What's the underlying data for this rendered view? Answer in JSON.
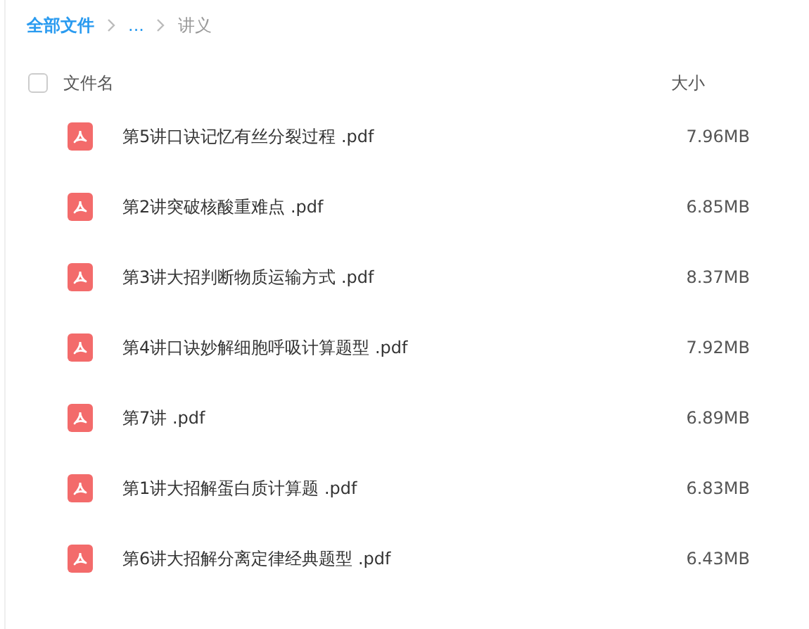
{
  "breadcrumb": [
    {
      "label": "全部文件",
      "kind": "link"
    },
    {
      "label": "...",
      "kind": "link"
    },
    {
      "label": "讲义",
      "kind": "current"
    }
  ],
  "table": {
    "select_all": {
      "checked": false
    },
    "columns": [
      "文件名",
      "大小"
    ],
    "rows": [
      {
        "name": "第5讲口诀记忆有丝分裂过程 .pdf",
        "size": "7.96MB"
      },
      {
        "name": "第2讲突破核酸重难点 .pdf",
        "size": "6.85MB"
      },
      {
        "name": "第3讲大招判断物质运输方式 .pdf",
        "size": "8.37MB"
      },
      {
        "name": "第4讲口诀妙解细胞呼吸计算题型 .pdf",
        "size": "7.92MB"
      },
      {
        "name": "第7讲 .pdf",
        "size": "6.89MB"
      },
      {
        "name": "第1讲大招解蛋白质计算题 .pdf",
        "size": "6.83MB"
      },
      {
        "name": "第6讲大招解分离定律经典题型 .pdf",
        "size": "6.43MB"
      }
    ]
  }
}
